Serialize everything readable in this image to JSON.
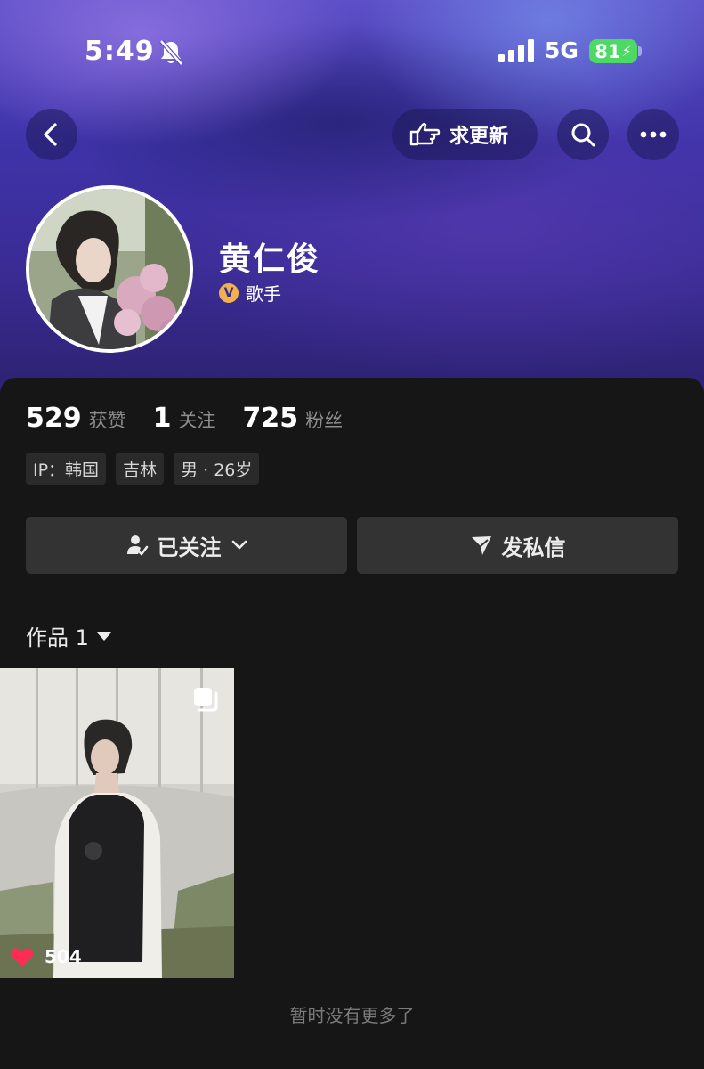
{
  "status_bar": {
    "time": "5:49",
    "network": "5G",
    "battery": "81",
    "icons": [
      "bell-mute-icon",
      "signal-icon",
      "battery-icon"
    ]
  },
  "header": {
    "update_label": "求更新",
    "icons": [
      "back-icon",
      "pointing-hand-icon",
      "search-icon",
      "more-icon"
    ]
  },
  "profile": {
    "name": "黄仁俊",
    "verify_mark": "V",
    "verify_label": "歌手"
  },
  "stats": [
    {
      "value": "529",
      "label": "获赞"
    },
    {
      "value": "1",
      "label": "关注"
    },
    {
      "value": "725",
      "label": "粉丝"
    }
  ],
  "tags": [
    "IP：韩国",
    "吉林",
    "男 · 26岁"
  ],
  "actions": {
    "follow_label": "已关注",
    "message_label": "发私信"
  },
  "works": {
    "label": "作品 1",
    "items": [
      {
        "likes": "504"
      }
    ]
  },
  "footer": {
    "no_more": "暂时没有更多了"
  },
  "colors": {
    "accent_purple": "#3f33a9",
    "panel_bg": "#161616",
    "like_red": "#fe2c55",
    "badge_gold": "#f2b24b",
    "battery_green": "#4cd964"
  }
}
